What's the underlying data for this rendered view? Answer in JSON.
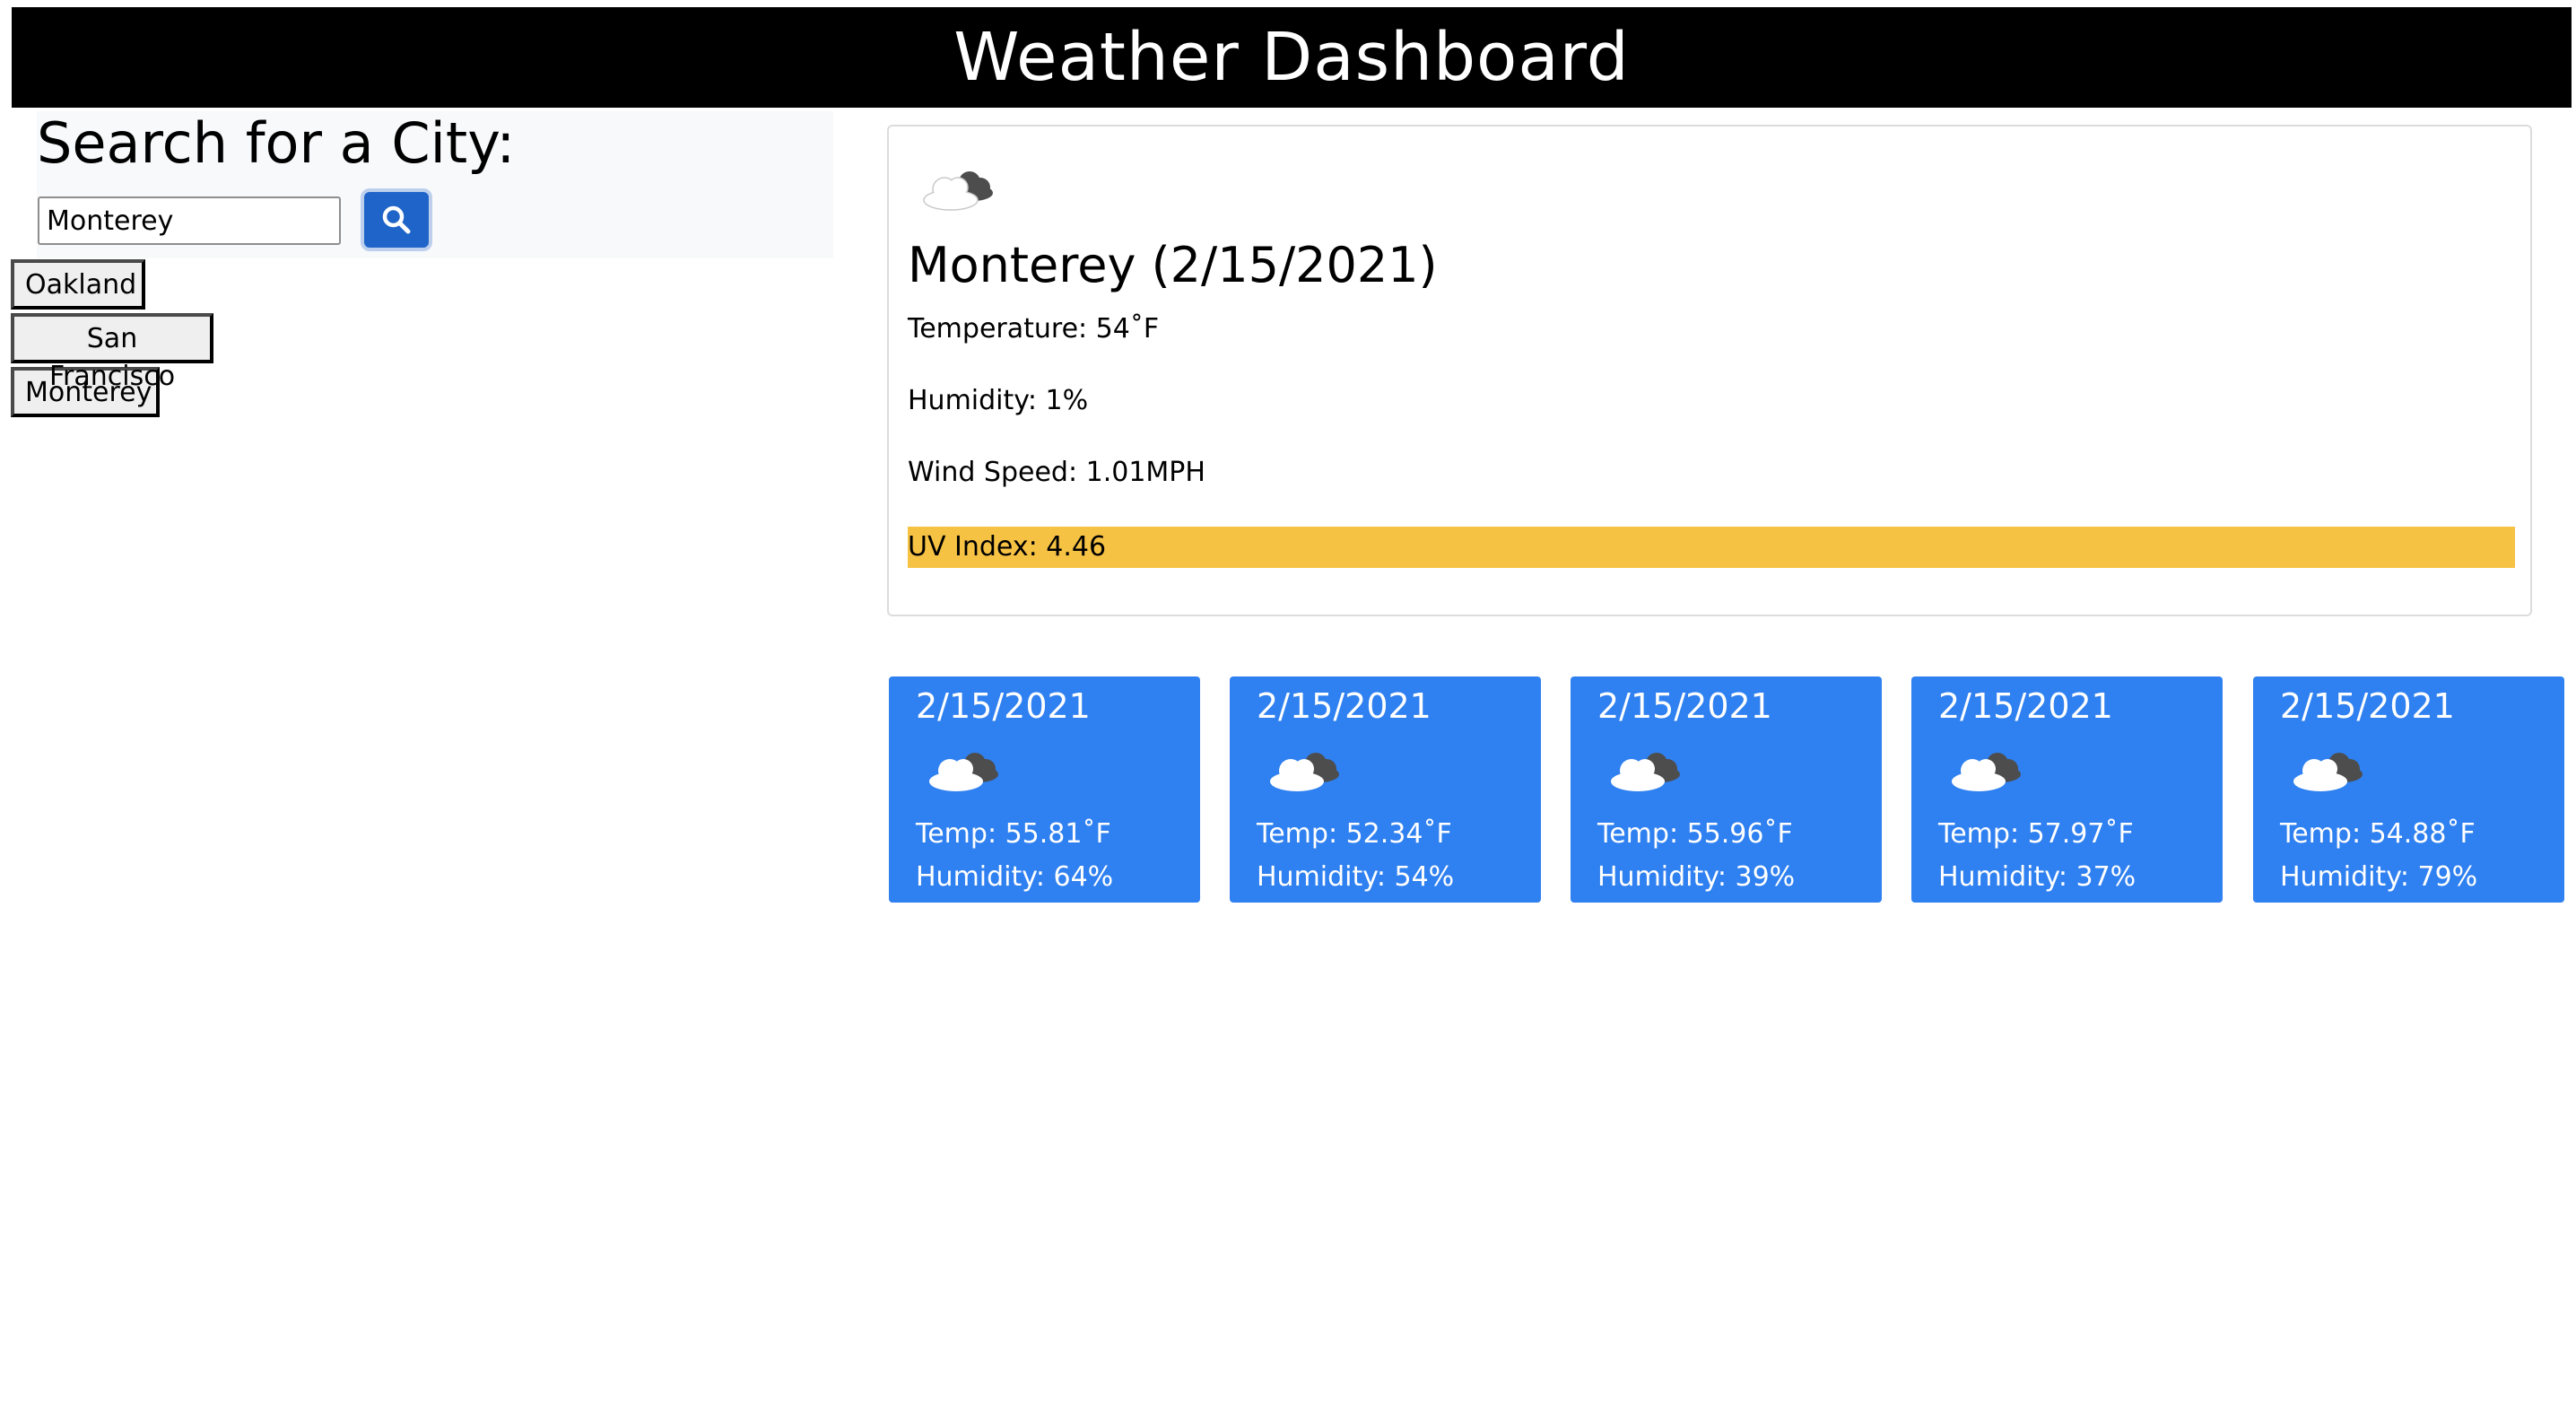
{
  "header": {
    "title": "Weather Dashboard"
  },
  "search": {
    "title": "Search for a City:",
    "input_value": "Monterey",
    "button_icon": "search-icon"
  },
  "history": [
    "Oakland",
    "San Francisco",
    "Monterey"
  ],
  "current": {
    "icon": "partly-cloudy-icon",
    "city_date": "Monterey (2/15/2021)",
    "temperature": "Temperature: 54˚F",
    "humidity": "Humidity: 1%",
    "wind": "Wind Speed: 1.01MPH",
    "uv": "UV Index: 4.46",
    "uv_color": "#f6c244"
  },
  "forecast": [
    {
      "date": "2/15/2021",
      "icon": "partly-cloudy-icon",
      "temp": "Temp: 55.81˚F",
      "humidity": "Humidity: 64%"
    },
    {
      "date": "2/15/2021",
      "icon": "partly-cloudy-icon",
      "temp": "Temp: 52.34˚F",
      "humidity": "Humidity: 54%"
    },
    {
      "date": "2/15/2021",
      "icon": "partly-cloudy-icon",
      "temp": "Temp: 55.96˚F",
      "humidity": "Humidity: 39%"
    },
    {
      "date": "2/15/2021",
      "icon": "partly-cloudy-icon",
      "temp": "Temp: 57.97˚F",
      "humidity": "Humidity: 37%"
    },
    {
      "date": "2/15/2021",
      "icon": "partly-cloudy-icon",
      "temp": "Temp: 54.88˚F",
      "humidity": "Humidity: 79%"
    }
  ],
  "colors": {
    "header_bg": "#000000",
    "forecast_bg": "#2f80f0",
    "search_button": "#1f64c8"
  }
}
